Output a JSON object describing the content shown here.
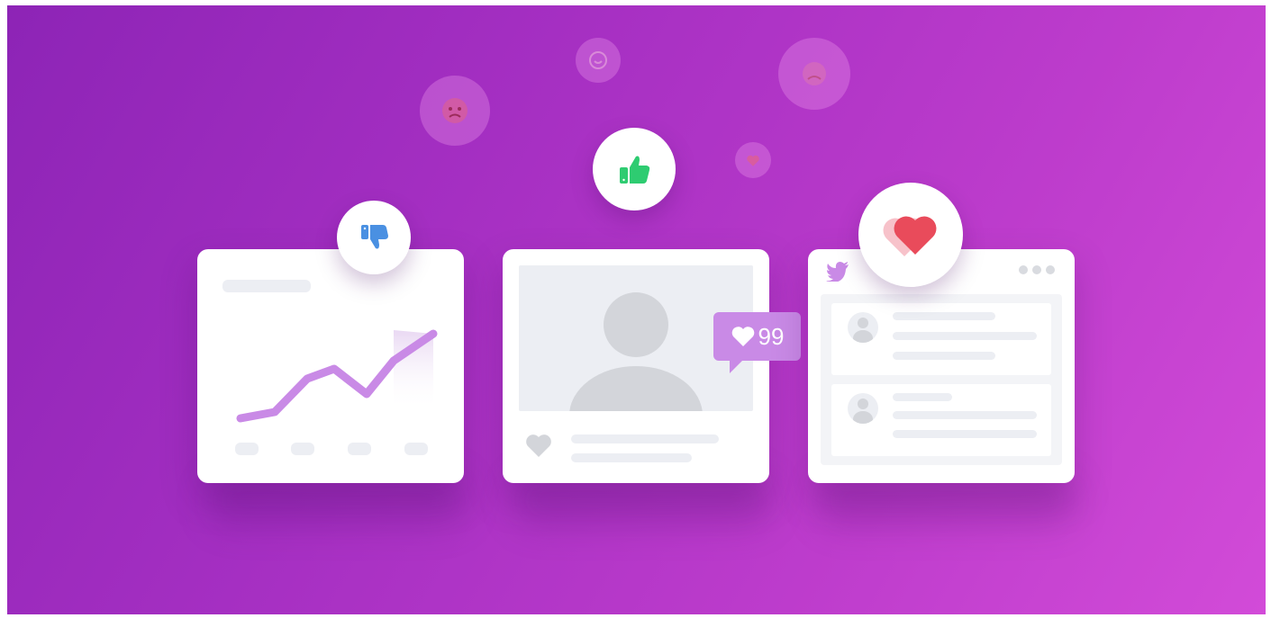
{
  "like_badge": {
    "count": "99"
  },
  "colors": {
    "background_start": "#8d24b6",
    "background_end": "#d24bd8",
    "chart_line": "#c98ae6",
    "thumbs_up": "#2ecc71",
    "thumbs_down": "#4a90e2",
    "heart": "#e94b5b",
    "twitter": "#c98ae6"
  },
  "icons": [
    "angry-emoji-icon",
    "smile-emoji-icon",
    "sad-emoji-icon",
    "small-heart-emoji-icon",
    "thumbs-up-icon",
    "thumbs-down-icon",
    "heart-icon",
    "twitter-bird-icon",
    "more-dots-icon",
    "avatar-icon",
    "heart-outline-icon"
  ]
}
